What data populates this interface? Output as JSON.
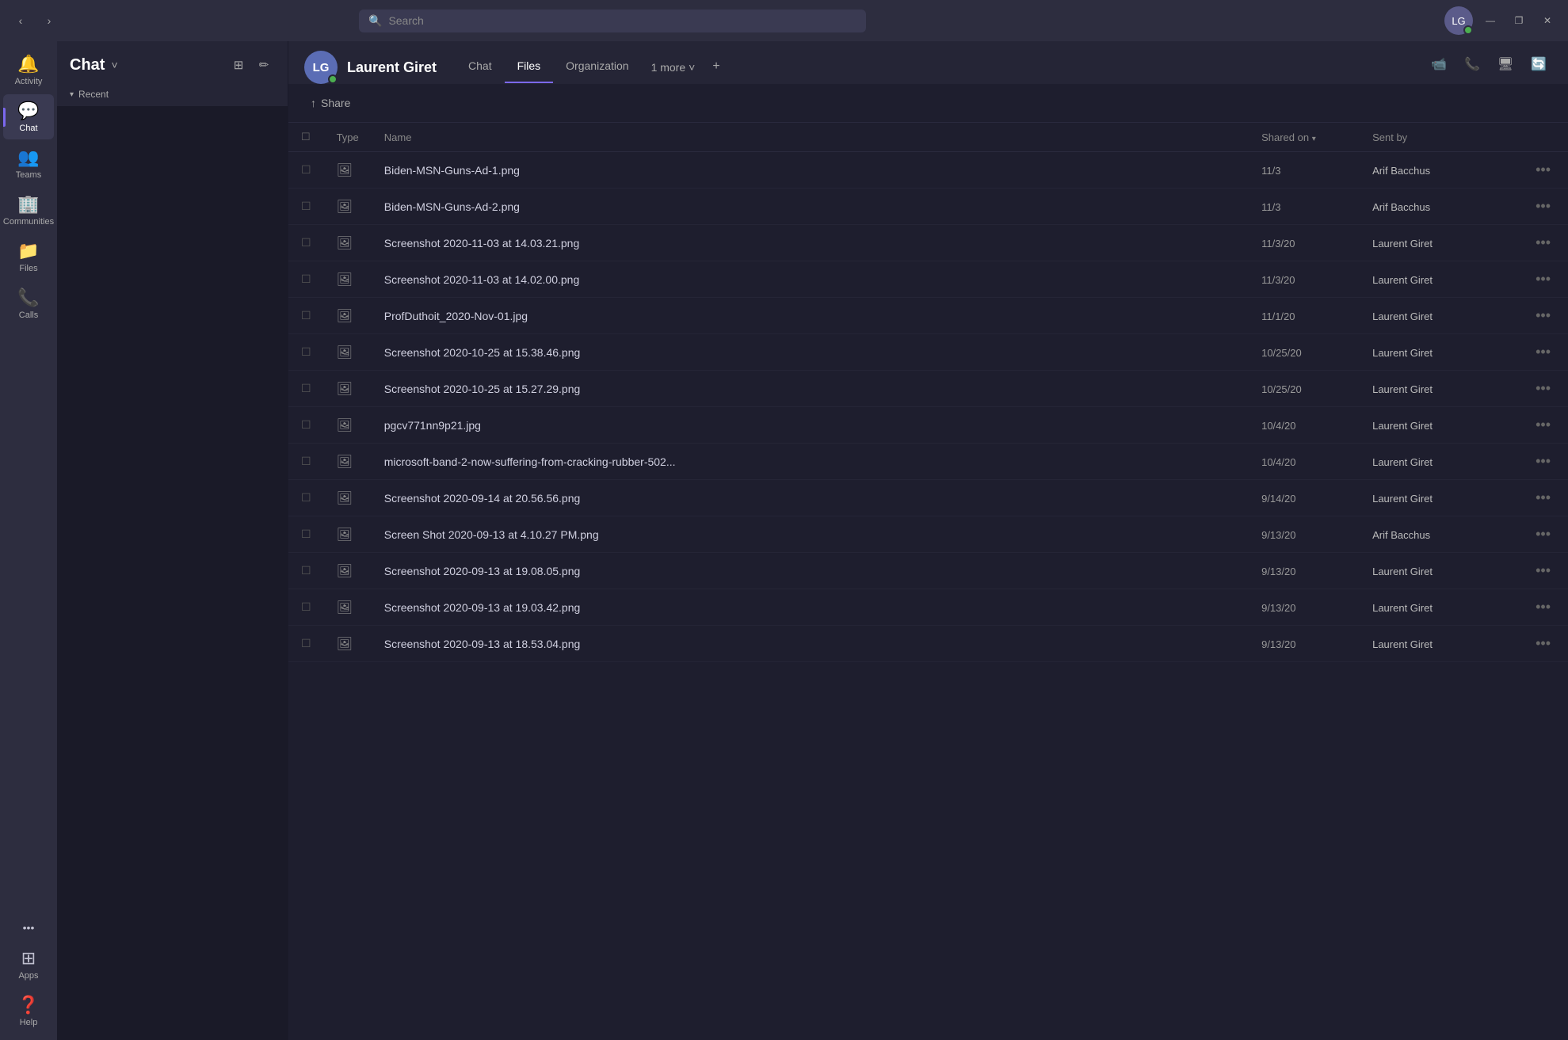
{
  "titleBar": {
    "searchPlaceholder": "Search",
    "navBack": "‹",
    "navForward": "›",
    "windowButtons": [
      "—",
      "❐",
      "✕"
    ]
  },
  "sidebar": {
    "items": [
      {
        "id": "activity",
        "label": "Activity",
        "icon": "🔔"
      },
      {
        "id": "chat",
        "label": "Chat",
        "icon": "💬",
        "active": true
      },
      {
        "id": "teams",
        "label": "Teams",
        "icon": "👥"
      },
      {
        "id": "communities",
        "label": "Communities",
        "icon": "🏢"
      },
      {
        "id": "files",
        "label": "Files",
        "icon": "📁"
      },
      {
        "id": "calls",
        "label": "Calls",
        "icon": "📞"
      }
    ],
    "moreLabel": "•••",
    "appsLabel": "Apps",
    "helpLabel": "Help"
  },
  "chatPanel": {
    "title": "Chat",
    "recentLabel": "Recent",
    "filterIcon": "⊞",
    "editIcon": "✏"
  },
  "contentHeader": {
    "userName": "Laurent Giret",
    "userInitials": "LG",
    "tabs": [
      {
        "id": "chat",
        "label": "Chat",
        "active": false
      },
      {
        "id": "files",
        "label": "Files",
        "active": true
      },
      {
        "id": "organization",
        "label": "Organization",
        "active": false
      }
    ],
    "moreTab": "1 more",
    "addTab": "+",
    "icons": [
      "📹",
      "📞",
      "🖥",
      "🔄"
    ]
  },
  "filesArea": {
    "shareLabel": "Share",
    "columns": {
      "type": "Type",
      "name": "Name",
      "sharedOn": "Shared on",
      "sentBy": "Sent by"
    },
    "files": [
      {
        "type": "image",
        "name": "Biden-MSN-Guns-Ad-1.png",
        "sharedOn": "11/3",
        "sentBy": "Arif Bacchus"
      },
      {
        "type": "image",
        "name": "Biden-MSN-Guns-Ad-2.png",
        "sharedOn": "11/3",
        "sentBy": "Arif Bacchus"
      },
      {
        "type": "image",
        "name": "Screenshot 2020-11-03 at 14.03.21.png",
        "sharedOn": "11/3/20",
        "sentBy": "Laurent Giret"
      },
      {
        "type": "image",
        "name": "Screenshot 2020-11-03 at 14.02.00.png",
        "sharedOn": "11/3/20",
        "sentBy": "Laurent Giret"
      },
      {
        "type": "image",
        "name": "ProfDuthoit_2020-Nov-01.jpg",
        "sharedOn": "11/1/20",
        "sentBy": "Laurent Giret"
      },
      {
        "type": "image",
        "name": "Screenshot 2020-10-25 at 15.38.46.png",
        "sharedOn": "10/25/20",
        "sentBy": "Laurent Giret"
      },
      {
        "type": "image",
        "name": "Screenshot 2020-10-25 at 15.27.29.png",
        "sharedOn": "10/25/20",
        "sentBy": "Laurent Giret"
      },
      {
        "type": "image",
        "name": "pgcv771nn9p21.jpg",
        "sharedOn": "10/4/20",
        "sentBy": "Laurent Giret"
      },
      {
        "type": "image",
        "name": "microsoft-band-2-now-suffering-from-cracking-rubber-502...",
        "sharedOn": "10/4/20",
        "sentBy": "Laurent Giret"
      },
      {
        "type": "image",
        "name": "Screenshot 2020-09-14 at 20.56.56.png",
        "sharedOn": "9/14/20",
        "sentBy": "Laurent Giret"
      },
      {
        "type": "image",
        "name": "Screen Shot 2020-09-13 at 4.10.27 PM.png",
        "sharedOn": "9/13/20",
        "sentBy": "Arif Bacchus"
      },
      {
        "type": "image",
        "name": "Screenshot 2020-09-13 at 19.08.05.png",
        "sharedOn": "9/13/20",
        "sentBy": "Laurent Giret"
      },
      {
        "type": "image",
        "name": "Screenshot 2020-09-13 at 19.03.42.png",
        "sharedOn": "9/13/20",
        "sentBy": "Laurent Giret"
      },
      {
        "type": "image",
        "name": "Screenshot 2020-09-13 at 18.53.04.png",
        "sharedOn": "9/13/20",
        "sentBy": "Laurent Giret"
      }
    ]
  }
}
